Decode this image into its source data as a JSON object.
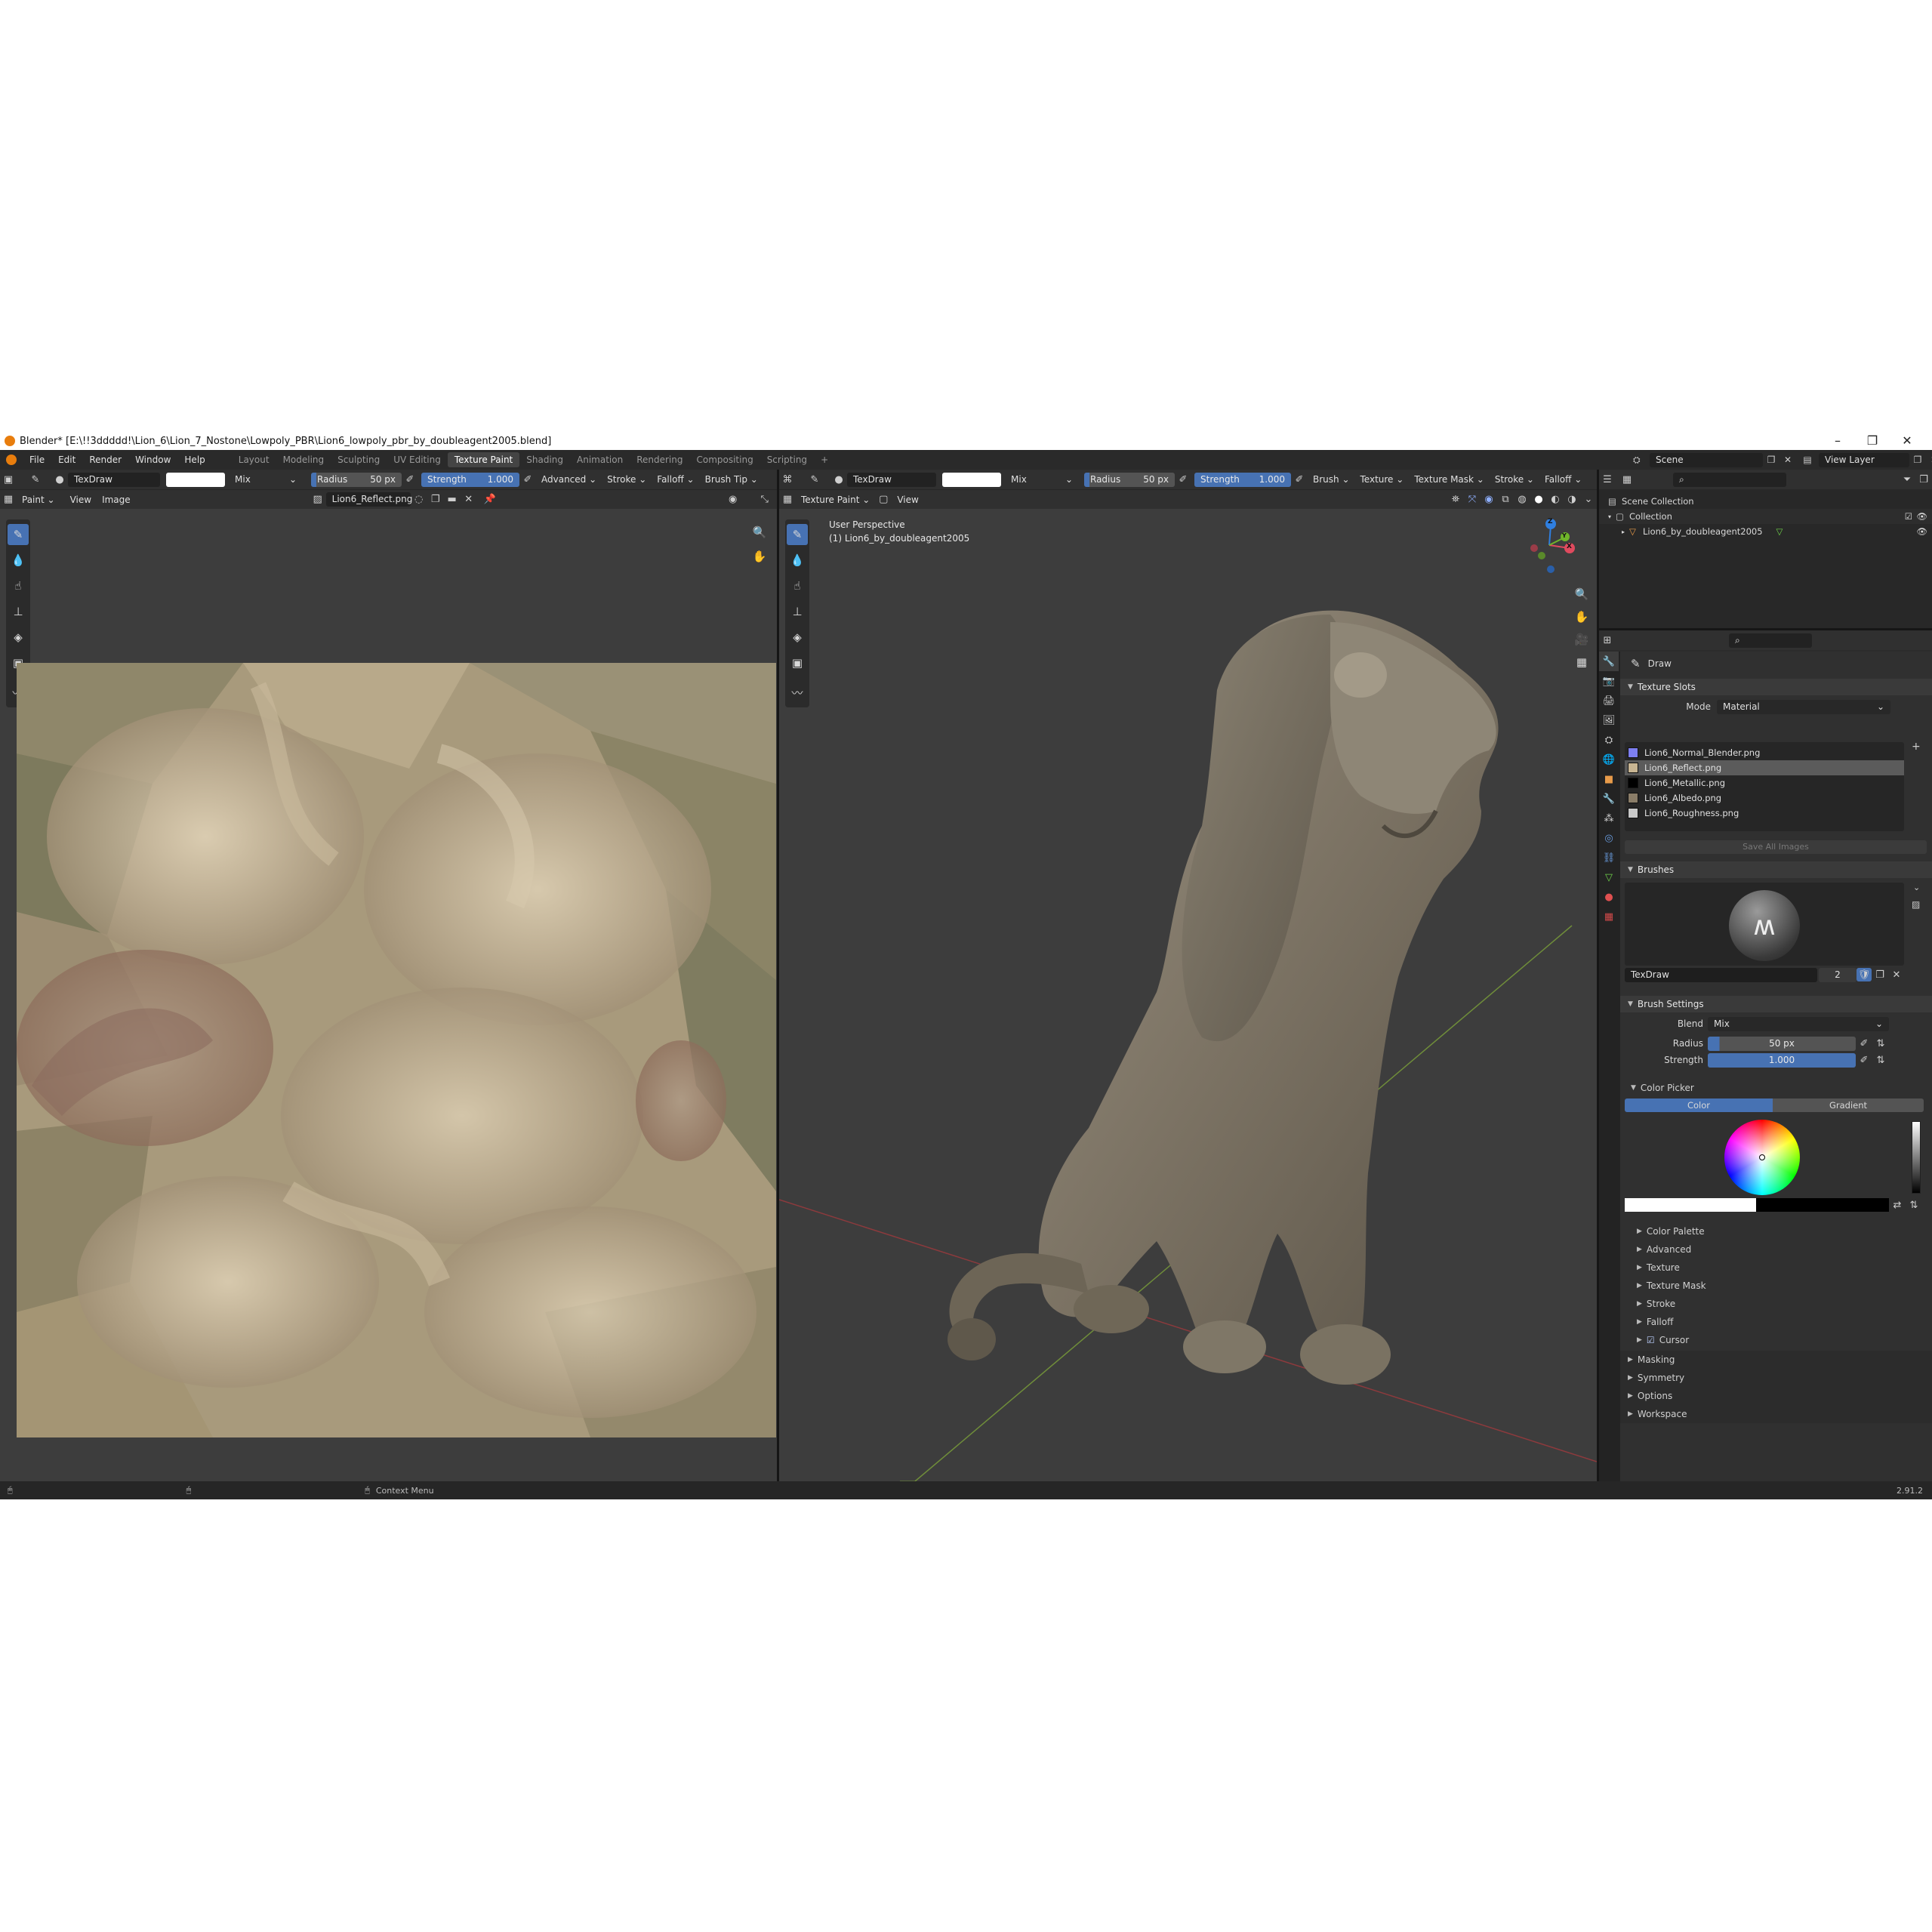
{
  "window": {
    "title": "Blender* [E:\\!!3ddddd!\\Lion_6\\Lion_7_Nostone\\Lowpoly_PBR\\Lion6_lowpoly_pbr_by_doubleagent2005.blend]"
  },
  "menus": [
    "File",
    "Edit",
    "Render",
    "Window",
    "Help"
  ],
  "workspaces": [
    "Layout",
    "Modeling",
    "Sculpting",
    "UV Editing",
    "Texture Paint",
    "Shading",
    "Animation",
    "Rendering",
    "Compositing",
    "Scripting"
  ],
  "active_workspace_index": 4,
  "plus_tab": "+",
  "scene": {
    "name": "Scene",
    "view_layer": "View Layer"
  },
  "tool_header": {
    "brush": "TexDraw",
    "blend": "Mix",
    "radius_label": "Radius",
    "radius_value": "50 px",
    "strength_label": "Strength",
    "strength_value": "1.000",
    "menus_left": [
      "Advanced",
      "Stroke",
      "Falloff",
      "Brush Tip"
    ],
    "menus_right": [
      "Brush",
      "Texture",
      "Texture Mask",
      "Stroke",
      "Falloff"
    ]
  },
  "image_editor": {
    "mode": "Paint",
    "menus": [
      "View",
      "Image"
    ],
    "image_name": "Lion6_Reflect.png"
  },
  "viewport": {
    "mode": "Texture Paint",
    "menus": [
      "View"
    ],
    "perspective": "User Perspective",
    "object_label": "(1) Lion6_by_doubleagent2005",
    "axis": {
      "z": "Z",
      "x": "X",
      "y": "Y"
    }
  },
  "outliner": {
    "scene_collection": "Scene Collection",
    "collection": "Collection",
    "object": "Lion6_by_doubleagent2005"
  },
  "properties": {
    "tool": "Draw",
    "texture_slots": {
      "title": "Texture Slots",
      "mode_label": "Mode",
      "mode_value": "Material",
      "slots": [
        {
          "name": "Lion6_Normal_Blender.png",
          "color": "#7d7ff0"
        },
        {
          "name": "Lion6_Reflect.png",
          "color": "#c8b592"
        },
        {
          "name": "Lion6_Metallic.png",
          "color": "#000000"
        },
        {
          "name": "Lion6_Albedo.png",
          "color": "#8a7d68"
        },
        {
          "name": "Lion6_Roughness.png",
          "color": "#c8c8c8"
        }
      ],
      "selected": 1,
      "save_all": "Save All Images"
    },
    "brushes": {
      "title": "Brushes",
      "name": "TexDraw",
      "users": "2"
    },
    "brush_settings": {
      "title": "Brush Settings",
      "blend_label": "Blend",
      "blend_value": "Mix",
      "radius_label": "Radius",
      "radius_value": "50 px",
      "strength_label": "Strength",
      "strength_value": "1.000"
    },
    "color_picker": {
      "title": "Color Picker",
      "tab_color": "Color",
      "tab_gradient": "Gradient"
    },
    "subpanels": [
      "Color Palette",
      "Advanced",
      "Texture",
      "Texture Mask",
      "Stroke",
      "Falloff",
      "Cursor"
    ],
    "panels": [
      "Masking",
      "Symmetry",
      "Options",
      "Workspace"
    ]
  },
  "status": {
    "context_menu": "Context Menu",
    "version": "2.91.2"
  }
}
